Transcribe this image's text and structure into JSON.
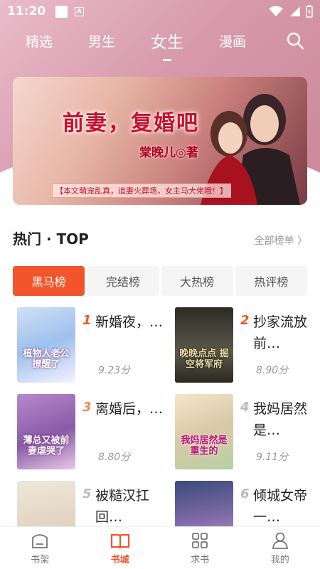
{
  "status_bar": {
    "time": "11:20"
  },
  "top_nav": {
    "tabs": [
      {
        "label": "精选"
      },
      {
        "label": "男生"
      },
      {
        "label": "女生",
        "active": true
      },
      {
        "label": "漫画"
      }
    ]
  },
  "banner": {
    "title": "前妻，复婚吧",
    "author": "棠晚儿◎著",
    "tagline": "【本文萌宠乱真，追妻火葬场，女主马大佬哦！】"
  },
  "section": {
    "title": "热门 · TOP",
    "more": "全部榜单 〉"
  },
  "rank_tabs": [
    {
      "label": "黑马榜",
      "active": true
    },
    {
      "label": "完结榜"
    },
    {
      "label": "大热榜"
    },
    {
      "label": "热评榜"
    }
  ],
  "books": [
    {
      "rank": "1",
      "title": "新婚夜，…",
      "score": "9.23分",
      "cover_text": "植物人老公撩醒了",
      "rank_color": "#f2552c"
    },
    {
      "rank": "2",
      "title": "抄家流放前…",
      "score": "8.90分",
      "cover_text": "晚晚点点 掘空将军府",
      "rank_color": "#f2552c"
    },
    {
      "rank": "3",
      "title": "离婚后，…",
      "score": "8.80分",
      "cover_text": "薄总又被前妻虐哭了",
      "rank_color": "#f08a5d"
    },
    {
      "rank": "4",
      "title": "我妈居然是…",
      "score": "9.11分",
      "cover_text": "我妈居然是重生的",
      "rank_color": "#bbbbbb"
    },
    {
      "rank": "5",
      "title": "被糙汉扛回…",
      "score": "",
      "cover_text": "",
      "rank_color": "#bbbbbb"
    },
    {
      "rank": "6",
      "title": "倾城女帝一…",
      "score": "",
      "cover_text": "",
      "rank_color": "#bbbbbb"
    }
  ],
  "bottom_nav": [
    {
      "label": "书架",
      "icon": "bookshelf-icon"
    },
    {
      "label": "书城",
      "icon": "open-book-icon",
      "active": true
    },
    {
      "label": "求书",
      "icon": "grid-icon"
    },
    {
      "label": "我的",
      "icon": "person-icon"
    }
  ],
  "colors": {
    "accent": "#f2552c",
    "header_pink": "#d79aab"
  }
}
